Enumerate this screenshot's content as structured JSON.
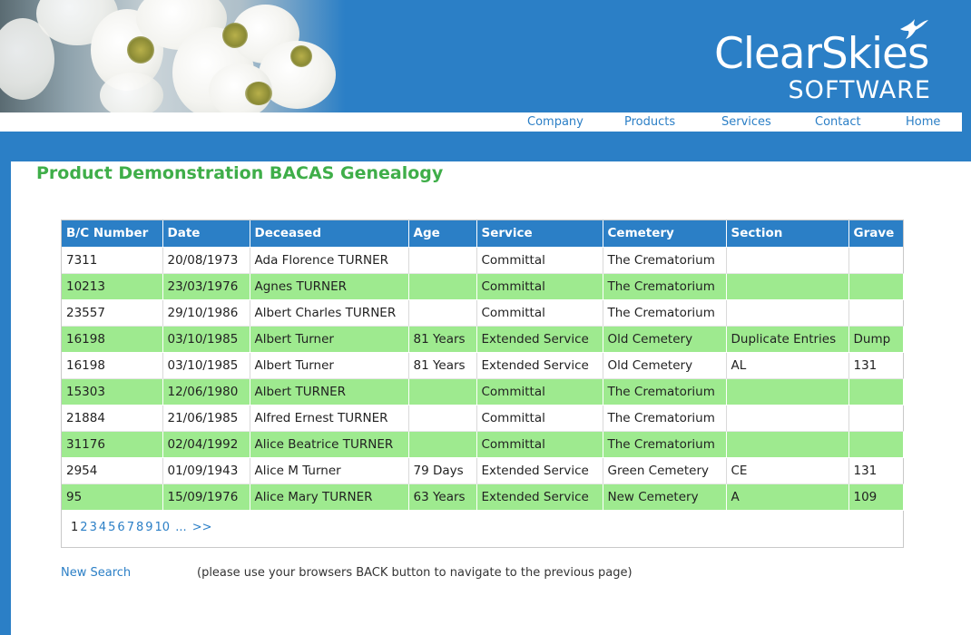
{
  "brand": {
    "name": "ClearSkies",
    "sub": "SOFTWARE"
  },
  "nav": [
    {
      "label": "Company"
    },
    {
      "label": "Products"
    },
    {
      "label": "Services"
    },
    {
      "label": "Contact"
    },
    {
      "label": "Home"
    }
  ],
  "page_title": "Product Demonstration BACAS Genealogy",
  "table": {
    "columns": [
      "B/C Number",
      "Date",
      "Deceased",
      "Age",
      "Service",
      "Cemetery",
      "Section",
      "Grave"
    ],
    "rows": [
      [
        "7311",
        "20/08/1973",
        "Ada Florence TURNER",
        "",
        "Committal",
        "The Crematorium",
        "",
        ""
      ],
      [
        "10213",
        "23/03/1976",
        "Agnes TURNER",
        "",
        "Committal",
        "The Crematorium",
        "",
        ""
      ],
      [
        "23557",
        "29/10/1986",
        "Albert Charles TURNER",
        "",
        "Committal",
        "The Crematorium",
        "",
        ""
      ],
      [
        "16198",
        "03/10/1985",
        "Albert Turner",
        "81 Years",
        "Extended Service",
        "Old Cemetery",
        "Duplicate Entries",
        "Dump"
      ],
      [
        "16198",
        "03/10/1985",
        "Albert Turner",
        "81 Years",
        "Extended Service",
        "Old Cemetery",
        "AL",
        "131"
      ],
      [
        "15303",
        "12/06/1980",
        "Albert TURNER",
        "",
        "Committal",
        "The Crematorium",
        "",
        ""
      ],
      [
        "21884",
        "21/06/1985",
        "Alfred Ernest TURNER",
        "",
        "Committal",
        "The Crematorium",
        "",
        ""
      ],
      [
        "31176",
        "02/04/1992",
        "Alice Beatrice TURNER",
        "",
        "Committal",
        "The Crematorium",
        "",
        ""
      ],
      [
        "2954",
        "01/09/1943",
        "Alice M Turner",
        "79 Days",
        "Extended Service",
        "Green Cemetery",
        "CE",
        "131"
      ],
      [
        "95",
        "15/09/1976",
        "Alice Mary TURNER",
        "63 Years",
        "Extended Service",
        "New Cemetery",
        "A",
        "109"
      ]
    ]
  },
  "pager": {
    "current": "1",
    "pages": [
      "2",
      "3",
      "4",
      "5",
      "6",
      "7",
      "8",
      "9",
      "10",
      "...",
      ">>"
    ]
  },
  "new_search_label": "New Search",
  "back_note": "(please use your browsers BACK button to navigate to the previous page)",
  "colors": {
    "brand_blue": "#2b7fc6",
    "title_green": "#3fae49",
    "row_green": "#9eea8f"
  },
  "icons": {
    "logo_bird": "swallow-icon"
  }
}
